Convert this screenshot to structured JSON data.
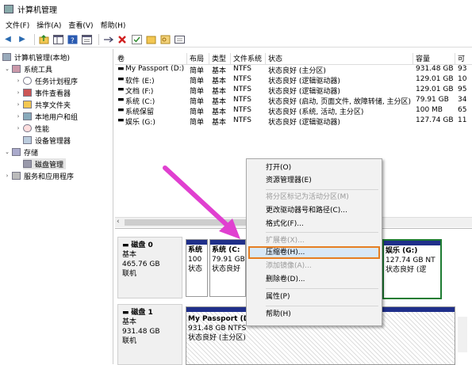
{
  "window": {
    "title": "计算机管理"
  },
  "menu": [
    "文件(F)",
    "操作(A)",
    "查看(V)",
    "帮助(H)"
  ],
  "toolbar_icons": [
    "back-arrow-icon",
    "forward-arrow-icon",
    "up-folder-icon",
    "show-hide-tree-icon",
    "help-icon",
    "properties-icon",
    "connect-icon",
    "delete-icon",
    "check-icon",
    "folder-icon",
    "key-icon",
    "export-icon"
  ],
  "tree": {
    "root": "计算机管理(本地)",
    "system_tools": "系统工具",
    "task_scheduler": "任务计划程序",
    "event_viewer": "事件查看器",
    "shared_folders": "共享文件夹",
    "local_users": "本地用户和组",
    "performance": "性能",
    "device_manager": "设备管理器",
    "storage": "存储",
    "disk_management": "磁盘管理",
    "services": "服务和应用程序"
  },
  "volumes": {
    "headers": [
      "卷",
      "布局",
      "类型",
      "文件系统",
      "状态",
      "容量",
      "可"
    ],
    "rows": [
      [
        "My Passport (D:)",
        "简单",
        "基本",
        "NTFS",
        "状态良好 (主分区)",
        "931.48 GB",
        "93"
      ],
      [
        "软件 (E:)",
        "简单",
        "基本",
        "NTFS",
        "状态良好 (逻辑驱动器)",
        "129.01 GB",
        "10"
      ],
      [
        "文档 (F:)",
        "简单",
        "基本",
        "NTFS",
        "状态良好 (逻辑驱动器)",
        "129.01 GB",
        "95"
      ],
      [
        "系统 (C:)",
        "简单",
        "基本",
        "NTFS",
        "状态良好 (启动, 页面文件, 故障转储, 主分区)",
        "79.91 GB",
        "34"
      ],
      [
        "系统保留",
        "简单",
        "基本",
        "NTFS",
        "状态良好 (系统, 活动, 主分区)",
        "100 MB",
        "65"
      ],
      [
        "娱乐 (G:)",
        "简单",
        "基本",
        "NTFS",
        "状态良好 (逻辑驱动器)",
        "127.74 GB",
        "11"
      ]
    ]
  },
  "disk0": {
    "title": "磁盘 0",
    "type": "基本",
    "size": "465.76 GB",
    "status": "联机",
    "p1": {
      "name": "系统",
      "size": "100",
      "status": "状态"
    },
    "p2": {
      "name": "系统 (C:",
      "size": "79.91 GB",
      "status": "状态良好"
    },
    "p3": {
      "name": "娱乐 (G:)",
      "size": "127.74 GB NT",
      "status": "状态良好 (逻"
    }
  },
  "disk1": {
    "title": "磁盘 1",
    "type": "基本",
    "size": "931.48 GB",
    "status": "联机",
    "p1": {
      "name": "My Passport (D:)",
      "size": "931.48 GB NTFS",
      "status": "状态良好 (主分区)"
    }
  },
  "context_menu": {
    "open": "打开(O)",
    "explorer": "资源管理器(E)",
    "mark_active": "将分区标记为活动分区(M)",
    "change_letter": "更改驱动器号和路径(C)...",
    "format": "格式化(F)...",
    "extend": "扩展卷(X)...",
    "shrink": "压缩卷(H)...",
    "add_mirror": "添加镜像(A)...",
    "delete": "删除卷(D)...",
    "properties": "属性(P)",
    "help": "帮助(H)"
  },
  "colors": {
    "primary_partition": "#1f2f8a",
    "logical_drive": "#1e7c32",
    "highlight": "#e67e22",
    "arrow": "#e040d0"
  }
}
